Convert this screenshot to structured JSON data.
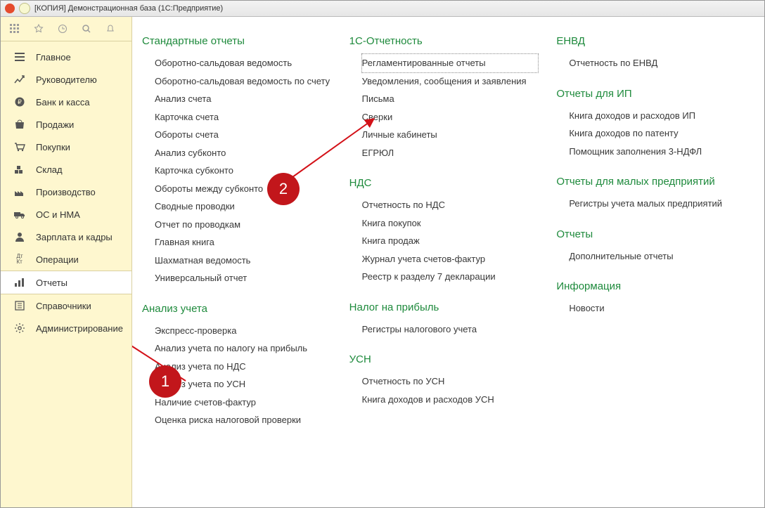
{
  "titlebar": {
    "title": "[КОПИЯ] Демонстрационная база  (1С:Предприятие)"
  },
  "sidebar": {
    "items": [
      {
        "label": "Главное",
        "icon": "menu-icon"
      },
      {
        "label": "Руководителю",
        "icon": "chart-up-icon"
      },
      {
        "label": "Банк и касса",
        "icon": "ruble-icon"
      },
      {
        "label": "Продажи",
        "icon": "bag-icon"
      },
      {
        "label": "Покупки",
        "icon": "cart-icon"
      },
      {
        "label": "Склад",
        "icon": "boxes-icon"
      },
      {
        "label": "Производство",
        "icon": "factory-icon"
      },
      {
        "label": "ОС и НМА",
        "icon": "truck-icon"
      },
      {
        "label": "Зарплата и кадры",
        "icon": "person-icon"
      },
      {
        "label": "Операции",
        "icon": "dtkt-icon"
      },
      {
        "label": "Отчеты",
        "icon": "bars-icon"
      },
      {
        "label": "Справочники",
        "icon": "book-icon"
      },
      {
        "label": "Администрирование",
        "icon": "gear-icon"
      }
    ]
  },
  "columns": [
    {
      "sections": [
        {
          "title": "Стандартные отчеты",
          "links": [
            "Оборотно-сальдовая ведомость",
            "Оборотно-сальдовая ведомость по счету",
            "Анализ счета",
            "Карточка счета",
            "Обороты счета",
            "Анализ субконто",
            "Карточка субконто",
            "Обороты между субконто",
            "Сводные проводки",
            "Отчет по проводкам",
            "Главная книга",
            "Шахматная ведомость",
            "Универсальный отчет"
          ]
        },
        {
          "title": "Анализ учета",
          "links": [
            "Экспресс-проверка",
            "Анализ учета по налогу на прибыль",
            "Анализ учета по НДС",
            "Анализ учета по УСН",
            "Наличие счетов-фактур",
            "Оценка риска налоговой проверки"
          ]
        }
      ]
    },
    {
      "sections": [
        {
          "title": "1С-Отчетность",
          "links": [
            "Регламентированные отчеты",
            "Уведомления, сообщения и заявления",
            "Письма",
            "Сверки",
            "Личные кабинеты",
            "ЕГРЮЛ"
          ]
        },
        {
          "title": "НДС",
          "links": [
            "Отчетность по НДС",
            "Книга покупок",
            "Книга продаж",
            "Журнал учета счетов-фактур",
            "Реестр к разделу 7 декларации"
          ]
        },
        {
          "title": "Налог на прибыль",
          "links": [
            "Регистры налогового учета"
          ]
        },
        {
          "title": "УСН",
          "links": [
            "Отчетность по УСН",
            "Книга доходов и расходов УСН"
          ]
        }
      ]
    },
    {
      "sections": [
        {
          "title": "ЕНВД",
          "links": [
            "Отчетность по ЕНВД"
          ]
        },
        {
          "title": "Отчеты для ИП",
          "links": [
            "Книга доходов и расходов ИП",
            "Книга доходов по патенту",
            "Помощник заполнения 3-НДФЛ"
          ]
        },
        {
          "title": "Отчеты для малых предприятий",
          "links": [
            "Регистры учета малых предприятий"
          ]
        },
        {
          "title": "Отчеты",
          "links": [
            "Дополнительные отчеты"
          ]
        },
        {
          "title": "Информация",
          "links": [
            "Новости"
          ]
        }
      ]
    }
  ],
  "annotations": {
    "one": "1",
    "two": "2"
  }
}
